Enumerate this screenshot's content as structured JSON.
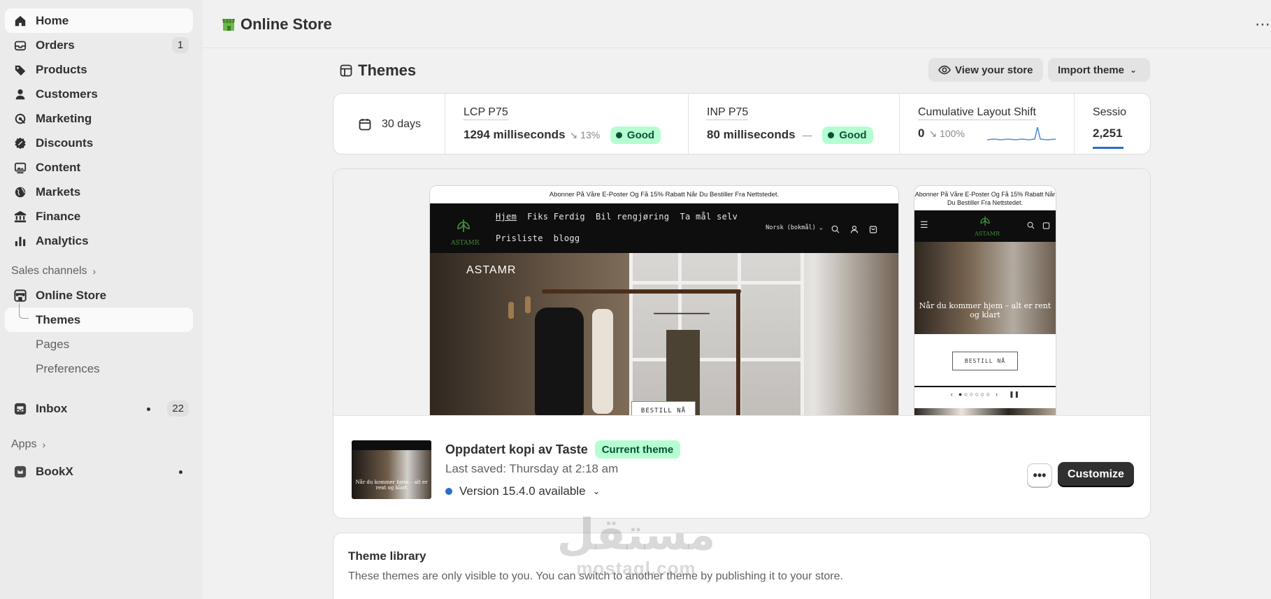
{
  "sidebar": {
    "items": [
      {
        "label": "Home",
        "icon": "home-icon"
      },
      {
        "label": "Orders",
        "icon": "orders-icon",
        "badge": "1"
      },
      {
        "label": "Products",
        "icon": "tag-icon"
      },
      {
        "label": "Customers",
        "icon": "person-icon"
      },
      {
        "label": "Marketing",
        "icon": "target-icon"
      },
      {
        "label": "Discounts",
        "icon": "discount-icon"
      },
      {
        "label": "Content",
        "icon": "content-icon"
      },
      {
        "label": "Markets",
        "icon": "globe-icon"
      },
      {
        "label": "Finance",
        "icon": "bank-icon"
      },
      {
        "label": "Analytics",
        "icon": "bar-chart-icon"
      }
    ],
    "sales_channels_label": "Sales channels",
    "online_store_label": "Online Store",
    "sub_items": [
      {
        "label": "Themes"
      },
      {
        "label": "Pages"
      },
      {
        "label": "Preferences"
      }
    ],
    "inbox_label": "Inbox",
    "inbox_badge": "22",
    "apps_label": "Apps",
    "bookx_label": "BookX"
  },
  "topbar": {
    "title": "Online Store",
    "more": "⋯"
  },
  "page": {
    "title": "Themes",
    "view_store_label": "View your store",
    "import_theme_label": "Import theme"
  },
  "metrics": {
    "range": "30 days",
    "lcp": {
      "label": "LCP P75",
      "value": "1294 milliseconds",
      "delta": "↘ 13%",
      "status": "Good"
    },
    "inp": {
      "label": "INP P75",
      "value": "80 milliseconds",
      "delta": "—",
      "status": "Good"
    },
    "cls": {
      "label": "Cumulative Layout Shift",
      "value": "0",
      "delta": "↘ 100%"
    },
    "sessions": {
      "label": "Sessio",
      "value": "2,251"
    }
  },
  "preview": {
    "announcement_desktop": "Abonner På Våre E-Poster Og Få 15% Rabatt Når Du Bestiller Fra Nettstedet.",
    "announcement_mobile": "Abonner På Våre E-Poster Og Få 15% Rabatt Når Du Bestiller Fra Nettstedet.",
    "nav_row1": [
      "Hjem",
      "Fiks Ferdig",
      "Bil rengjøring",
      "Ta mål selv"
    ],
    "nav_row2": [
      "Prisliste",
      "blogg"
    ],
    "language": "Norsk (bokmål)",
    "logo_text": "ASTAMR",
    "hero_brand": "ASTAMR",
    "cta": "BESTILL NÅ",
    "mobile_caption": "Når du kommer hjem – alt er rent og klart",
    "mobile_cta": "BESTILL NÅ"
  },
  "theme": {
    "name": "Oppdatert kopi av Taste",
    "status": "Current theme",
    "last_saved": "Last saved: Thursday at 2:18 am",
    "version": "Version 15.4.0 available",
    "more": "•••",
    "customize": "Customize",
    "thumb_caption": "Når du kommer hjem – alt er rent og klart"
  },
  "library": {
    "title": "Theme library",
    "description": "These themes are only visible to you. You can switch to another theme by publishing it to your store."
  },
  "watermark": {
    "arabic": "مستقل",
    "latin": "mostaql.com"
  },
  "colors": {
    "good_bg": "#b4fed2",
    "good_text": "#0c5132",
    "primary_button": "#303030",
    "version_dot": "#2c6ecb"
  }
}
